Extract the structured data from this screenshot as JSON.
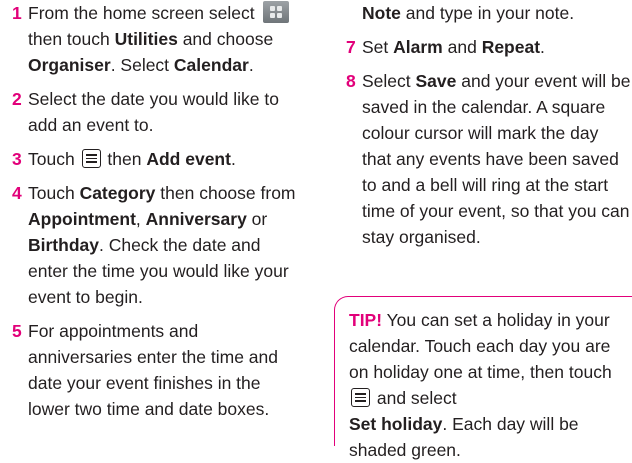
{
  "colors": {
    "accent": "#e2007a",
    "text": "#231f20"
  },
  "icons": {
    "home_menu": "grid-icon",
    "options": "menu-icon"
  },
  "steps_left": [
    {
      "num": "1",
      "p1": "From the home screen select ",
      "p2": "then touch ",
      "b1": "Utilities",
      "p3": " and choose ",
      "b2": "Organiser",
      "p4": ". Select ",
      "b3": "Calendar",
      "p5": "."
    },
    {
      "num": "2",
      "text": "Select the date you would like to add an event to."
    },
    {
      "num": "3",
      "p1": "Touch ",
      "p2": " then ",
      "b1": "Add event",
      "p3": "."
    },
    {
      "num": "4",
      "p1": "Touch ",
      "b1": "Category",
      "p2": " then choose from ",
      "b2": "Appointment",
      "p3": ", ",
      "b3": "Anniversary",
      "p4": " or ",
      "b4": "Birthday",
      "p5": ". Check the date and enter the time you would like your event to begin."
    },
    {
      "num": "5",
      "text": "For appointments and anniversaries enter the time and date your event finishes in the lower two time and date boxes."
    }
  ],
  "cont_right": {
    "b1": "Note",
    "p1": " and type in your note."
  },
  "steps_right": [
    {
      "num": "7",
      "p1": "Set ",
      "b1": "Alarm",
      "p2": " and ",
      "b2": "Repeat",
      "p3": "."
    },
    {
      "num": "8",
      "p1": "Select ",
      "b1": "Save",
      "p2": " and your event will be saved in the calendar. A square colour cursor will mark the day that any events have been saved to and a bell will ring at the start time of your event, so that you can stay organised."
    }
  ],
  "tip": {
    "label": "TIP!",
    "p1": " You can set a holiday in your calendar. Touch each day you are on holiday one at time, then touch ",
    "p2": " and select ",
    "b1": "Set holiday",
    "p3": ". Each day will be shaded green."
  }
}
